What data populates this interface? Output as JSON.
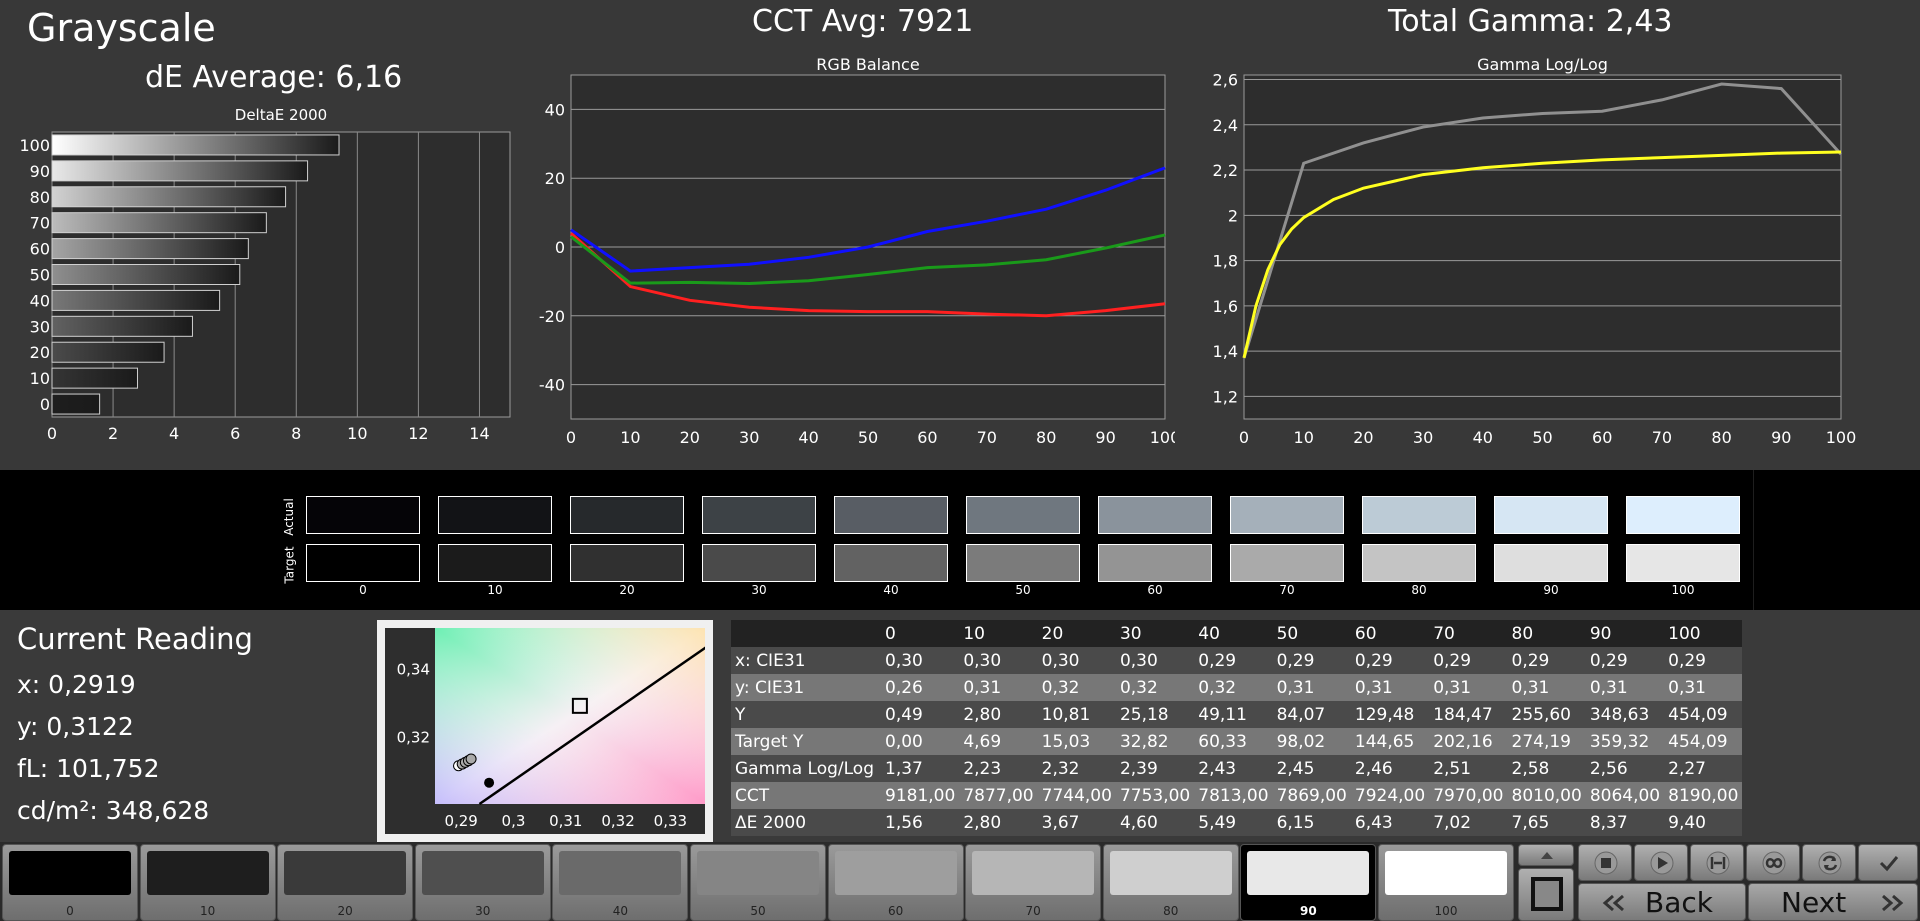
{
  "header": {
    "title": "Grayscale",
    "de_average": "dE Average: 6,16",
    "cct_avg": "CCT Avg: 7921",
    "total_gamma": "Total Gamma: 2,43"
  },
  "chart_data": [
    {
      "type": "bar",
      "title": "DeltaE 2000",
      "orientation": "horizontal",
      "categories": [
        "0",
        "10",
        "20",
        "30",
        "40",
        "50",
        "60",
        "70",
        "80",
        "90",
        "100"
      ],
      "values": [
        1.56,
        2.8,
        3.67,
        4.6,
        5.49,
        6.15,
        6.43,
        7.02,
        7.65,
        8.37,
        9.4
      ],
      "xlim": [
        0,
        15
      ],
      "xticks": [
        "0",
        "2",
        "4",
        "6",
        "8",
        "10",
        "12",
        "14"
      ]
    },
    {
      "type": "line",
      "title": "RGB Balance",
      "x": [
        0,
        10,
        20,
        30,
        40,
        50,
        60,
        70,
        80,
        90,
        100
      ],
      "ylim": [
        -50,
        50
      ],
      "yticks": [
        "40",
        "20",
        "0",
        "-20",
        "-40"
      ],
      "xticks": [
        "0",
        "10",
        "20",
        "30",
        "40",
        "50",
        "60",
        "70",
        "80",
        "90",
        "100"
      ],
      "series": [
        {
          "color": "#ff2020",
          "values": [
            4,
            -11.5,
            -15.5,
            -17.5,
            -18.5,
            -18.8,
            -18.8,
            -19.5,
            -20,
            -18.5,
            -16.5
          ]
        },
        {
          "color": "#1a9a1a",
          "values": [
            3,
            -10.5,
            -10.3,
            -10.6,
            -9.8,
            -8,
            -6,
            -5.2,
            -3.7,
            -0.3,
            3.5
          ]
        },
        {
          "color": "#1010ff",
          "values": [
            5,
            -7,
            -6,
            -5,
            -3,
            0,
            4.5,
            7.5,
            11,
            16.5,
            23
          ]
        }
      ]
    },
    {
      "type": "line",
      "title": "Gamma Log/Log",
      "x": [
        0,
        10,
        20,
        30,
        40,
        50,
        60,
        70,
        80,
        90,
        100
      ],
      "ylim": [
        1.1,
        2.62
      ],
      "yticks": [
        "2,6",
        "2,4",
        "2,2",
        "2",
        "1,8",
        "1,6",
        "1,4",
        "1,2"
      ],
      "xticks": [
        "0",
        "10",
        "20",
        "30",
        "40",
        "50",
        "60",
        "70",
        "80",
        "90",
        "100"
      ],
      "series": [
        {
          "color": "#909090",
          "values": [
            1.37,
            2.23,
            2.32,
            2.39,
            2.43,
            2.45,
            2.46,
            2.51,
            2.58,
            2.56,
            2.27
          ]
        },
        {
          "color": "#ffff20",
          "x": [
            0,
            2,
            4,
            6,
            8,
            10,
            15,
            20,
            30,
            40,
            50,
            60,
            70,
            80,
            90,
            100
          ],
          "values": [
            1.37,
            1.6,
            1.76,
            1.87,
            1.94,
            1.99,
            2.07,
            2.12,
            2.18,
            2.21,
            2.23,
            2.245,
            2.255,
            2.265,
            2.275,
            2.28
          ]
        }
      ]
    },
    {
      "type": "scatter",
      "title": "",
      "xlim": [
        0.285,
        0.337
      ],
      "ylim": [
        0.3,
        0.352
      ],
      "xticks": [
        "0,29",
        "0,3",
        "0,31",
        "0,32",
        "0,33"
      ],
      "yticks": [
        "0,34",
        "0,32"
      ],
      "target": {
        "x": 0.3127,
        "y": 0.329
      },
      "current": {
        "x": 0.2919,
        "y": 0.3122
      }
    }
  ],
  "swatches": {
    "actual_label": "Actual",
    "target_label": "Target",
    "labels": [
      "0",
      "10",
      "20",
      "30",
      "40",
      "50",
      "60",
      "70",
      "80",
      "90",
      "100"
    ],
    "actual_colors": [
      "#050407",
      "#121316",
      "#26292c",
      "#3d4246",
      "#585d64",
      "#6f777f",
      "#8a939c",
      "#a5b0ba",
      "#bccbd6",
      "#d6e6f3",
      "#ddeefd"
    ],
    "target_colors": [
      "#000000",
      "#1b1b1b",
      "#303030",
      "#4a4a4a",
      "#626262",
      "#7b7b7b",
      "#949494",
      "#aaaaaa",
      "#c4c4c4",
      "#dedede",
      "#e6e6e6"
    ]
  },
  "reading": {
    "title": "Current Reading",
    "x": "x: 0,2919",
    "y": "y: 0,3122",
    "fl": "fL: 101,752",
    "cdm2": "cd/m²: 348,628"
  },
  "table": {
    "headers": [
      "",
      "0",
      "10",
      "20",
      "30",
      "40",
      "50",
      "60",
      "70",
      "80",
      "90",
      "100"
    ],
    "rows": [
      {
        "label": "x: CIE31",
        "values": [
          "0,30",
          "0,30",
          "0,30",
          "0,30",
          "0,29",
          "0,29",
          "0,29",
          "0,29",
          "0,29",
          "0,29",
          "0,29"
        ]
      },
      {
        "label": "y: CIE31",
        "values": [
          "0,26",
          "0,31",
          "0,32",
          "0,32",
          "0,32",
          "0,31",
          "0,31",
          "0,31",
          "0,31",
          "0,31",
          "0,31"
        ]
      },
      {
        "label": "Y",
        "values": [
          "0,49",
          "2,80",
          "10,81",
          "25,18",
          "49,11",
          "84,07",
          "129,48",
          "184,47",
          "255,60",
          "348,63",
          "454,09"
        ]
      },
      {
        "label": "Target Y",
        "values": [
          "0,00",
          "4,69",
          "15,03",
          "32,82",
          "60,33",
          "98,02",
          "144,65",
          "202,16",
          "274,19",
          "359,32",
          "454,09"
        ]
      },
      {
        "label": "Gamma Log/Log",
        "values": [
          "1,37",
          "2,23",
          "2,32",
          "2,39",
          "2,43",
          "2,45",
          "2,46",
          "2,51",
          "2,58",
          "2,56",
          "2,27"
        ]
      },
      {
        "label": "CCT",
        "values": [
          "9181,00",
          "7877,00",
          "7744,00",
          "7753,00",
          "7813,00",
          "7869,00",
          "7924,00",
          "7970,00",
          "8010,00",
          "8064,00",
          "8190,00"
        ]
      },
      {
        "label": "ΔE 2000",
        "values": [
          "1,56",
          "2,80",
          "3,67",
          "4,60",
          "5,49",
          "6,15",
          "6,43",
          "7,02",
          "7,65",
          "8,37",
          "9,40"
        ]
      }
    ]
  },
  "patches": {
    "labels": [
      "0",
      "10",
      "20",
      "30",
      "40",
      "50",
      "60",
      "70",
      "80",
      "90",
      "100"
    ],
    "colors": [
      "#000000",
      "#1e1e1e",
      "#3a3a3a",
      "#4f4f4f",
      "#6a6a6a",
      "#858585",
      "#9e9e9e",
      "#b6b6b6",
      "#cfcfcf",
      "#e8e8e8",
      "#ffffff"
    ],
    "selected": "90"
  },
  "nav": {
    "back_label": "Back",
    "next_label": "Next"
  }
}
